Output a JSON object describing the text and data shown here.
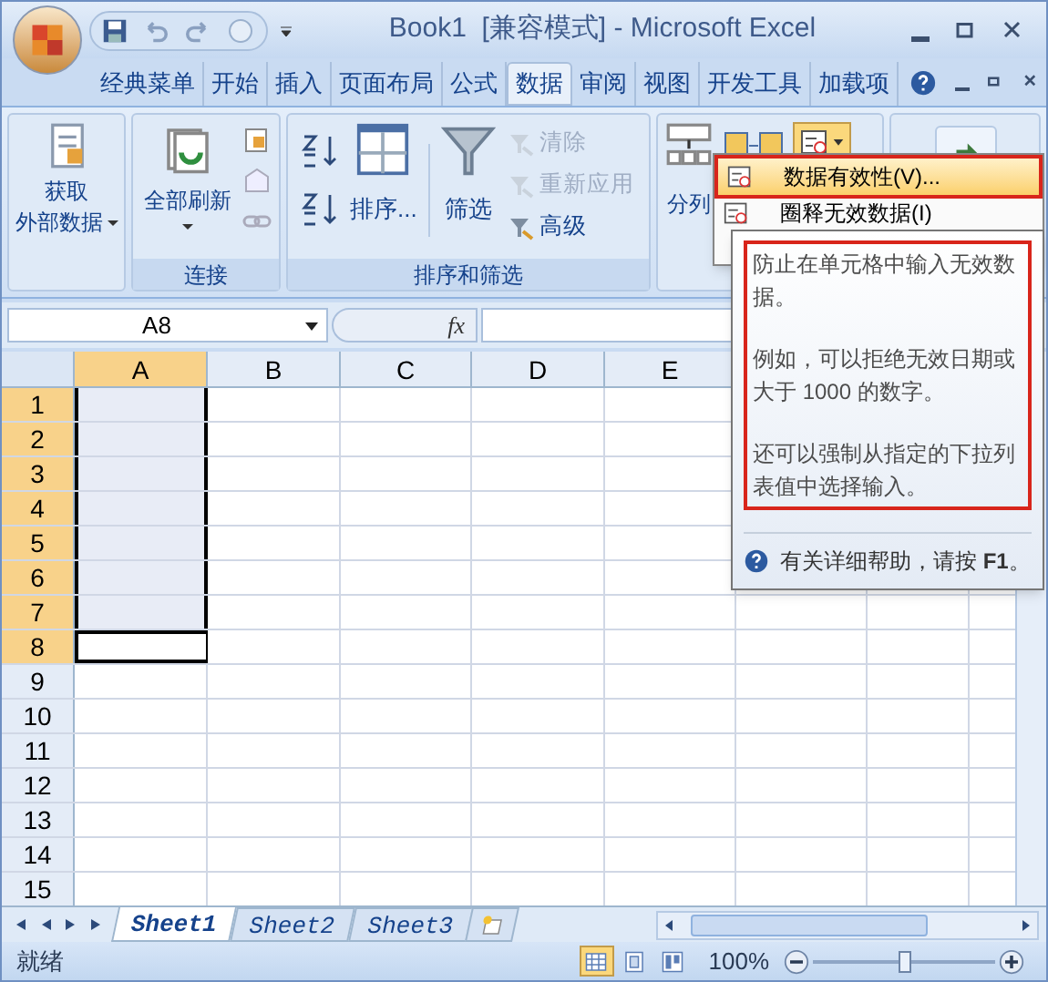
{
  "window": {
    "title": "Book1  [兼容模式] - Microsoft Excel"
  },
  "ribbon_tabs": [
    {
      "label": "经典菜单",
      "selected": false
    },
    {
      "label": "开始",
      "selected": false
    },
    {
      "label": "插入",
      "selected": false
    },
    {
      "label": "页面布局",
      "selected": false
    },
    {
      "label": "公式",
      "selected": false
    },
    {
      "label": "数据",
      "selected": true
    },
    {
      "label": "审阅",
      "selected": false
    },
    {
      "label": "视图",
      "selected": false
    },
    {
      "label": "开发工具",
      "selected": false
    },
    {
      "label": "加载项",
      "selected": false
    }
  ],
  "ribbon": {
    "get_data": {
      "line1": "获取",
      "line2": "外部数据"
    },
    "connections": {
      "refresh_all": "全部刷新",
      "group_label": "连接"
    },
    "sort_filter": {
      "sort": "排序...",
      "filter": "筛选",
      "clear": {
        "label": "清除",
        "disabled": true
      },
      "reapply": {
        "label": "重新应用",
        "disabled": true
      },
      "advanced": {
        "label": "高级",
        "disabled": false
      },
      "group_label": "排序和筛选"
    },
    "data_tools": {
      "text_to_columns": "分列"
    }
  },
  "dropdown_menu": {
    "items": [
      {
        "label": "数据有效性(V)...",
        "selected": true
      },
      {
        "label": "圈释无效数据(I)",
        "selected": false
      }
    ]
  },
  "tooltip": {
    "paragraphs": [
      "防止在单元格中输入无效数据。",
      "例如，可以拒绝无效日期或大于 1000 的数字。",
      "还可以强制从指定的下拉列表值中选择输入。"
    ],
    "help": "有关详细帮助，请按 **F1**。"
  },
  "formula_bar": {
    "name_box": "A8",
    "fx": "fx"
  },
  "sheet": {
    "columns": [
      {
        "label": "A",
        "selected": true
      },
      {
        "label": "B",
        "selected": false
      },
      {
        "label": "C",
        "selected": false
      },
      {
        "label": "D",
        "selected": false
      },
      {
        "label": "E",
        "selected": false
      }
    ],
    "rows": [
      {
        "label": "1",
        "selected": true,
        "active": false
      },
      {
        "label": "2",
        "selected": true,
        "active": false
      },
      {
        "label": "3",
        "selected": true,
        "active": false
      },
      {
        "label": "4",
        "selected": true,
        "active": false
      },
      {
        "label": "5",
        "selected": true,
        "active": false
      },
      {
        "label": "6",
        "selected": true,
        "active": false
      },
      {
        "label": "7",
        "selected": true,
        "active": false
      },
      {
        "label": "8",
        "selected": true,
        "active": true
      },
      {
        "label": "9",
        "selected": false,
        "active": false
      },
      {
        "label": "10",
        "selected": false,
        "active": false
      },
      {
        "label": "11",
        "selected": false,
        "active": false
      },
      {
        "label": "12",
        "selected": false,
        "active": false
      },
      {
        "label": "13",
        "selected": false,
        "active": false
      },
      {
        "label": "14",
        "selected": false,
        "active": false
      },
      {
        "label": "15",
        "selected": false,
        "active": false
      }
    ]
  },
  "sheet_tabs": [
    {
      "label": "Sheet1",
      "selected": true
    },
    {
      "label": "Sheet2",
      "selected": false
    },
    {
      "label": "Sheet3",
      "selected": false
    }
  ],
  "status_bar": {
    "status": "就绪",
    "zoom": "100%",
    "zoom_slider": {
      "level": 0.5
    },
    "views": [
      {
        "kind": "normal",
        "selected": true
      },
      {
        "kind": "page_layout",
        "selected": false
      },
      {
        "kind": "page_break",
        "selected": false
      }
    ]
  }
}
